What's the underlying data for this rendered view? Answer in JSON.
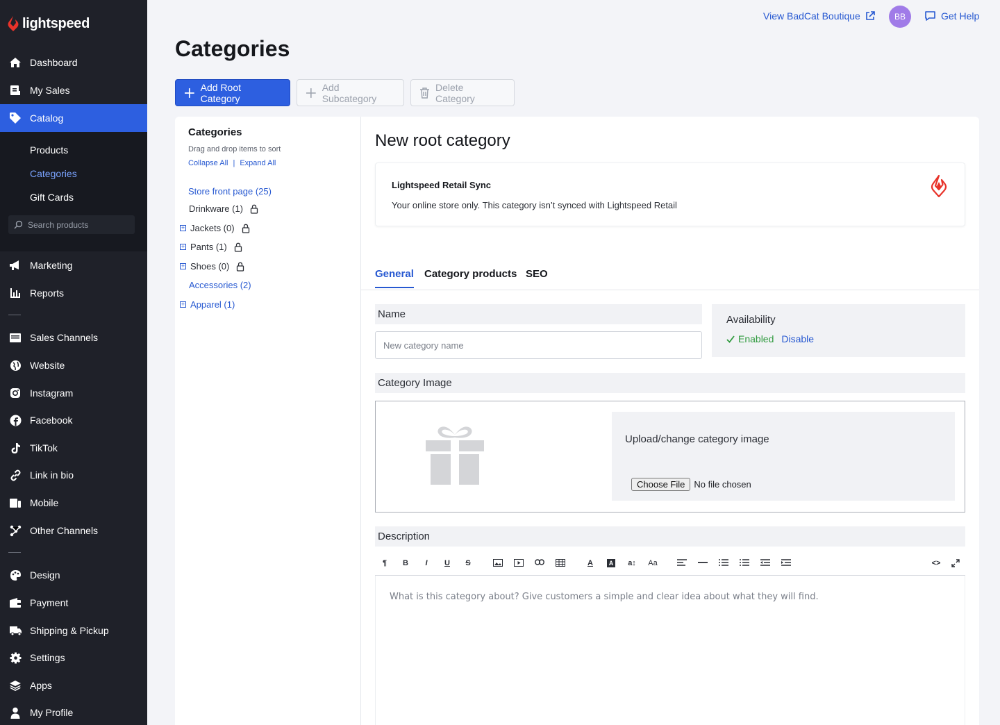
{
  "brand": {
    "name": "lightspeed",
    "accent": "#2d5fe0",
    "logo_red": "#e8332a"
  },
  "sidebar": {
    "items": [
      {
        "label": "Dashboard",
        "icon": "home-icon"
      },
      {
        "label": "My Sales",
        "icon": "sales-icon"
      },
      {
        "label": "Catalog",
        "icon": "tag-icon"
      },
      {
        "label": "Marketing",
        "icon": "megaphone-icon"
      },
      {
        "label": "Reports",
        "icon": "bar-chart-icon"
      },
      {
        "label": "Sales Channels",
        "icon": "storefront-icon"
      },
      {
        "label": "Website",
        "icon": "globe-icon"
      },
      {
        "label": "Instagram",
        "icon": "instagram-icon"
      },
      {
        "label": "Facebook",
        "icon": "facebook-icon"
      },
      {
        "label": "TikTok",
        "icon": "tiktok-icon"
      },
      {
        "label": "Link in bio",
        "icon": "link-icon"
      },
      {
        "label": "Mobile",
        "icon": "mobile-icon"
      },
      {
        "label": "Other Channels",
        "icon": "channels-icon"
      },
      {
        "label": "Design",
        "icon": "palette-icon"
      },
      {
        "label": "Payment",
        "icon": "wallet-icon"
      },
      {
        "label": "Shipping & Pickup",
        "icon": "truck-icon"
      },
      {
        "label": "Settings",
        "icon": "gear-icon"
      },
      {
        "label": "Apps",
        "icon": "layers-icon"
      },
      {
        "label": "My Profile",
        "icon": "user-icon"
      }
    ],
    "catalog_sub": [
      "Products",
      "Categories",
      "Gift Cards"
    ],
    "search_placeholder": "Search products"
  },
  "topbar": {
    "view_store": "View BadCat Boutique",
    "avatar_initials": "BB",
    "help": "Get Help"
  },
  "page": {
    "title": "Categories",
    "buttons": {
      "add_root": "Add Root Category",
      "add_sub": "Add Subcategory",
      "delete": "Delete Category"
    }
  },
  "tree": {
    "title": "Categories",
    "hint": "Drag and drop items to sort",
    "collapse": "Collapse All",
    "expand": "Expand All",
    "nodes": [
      {
        "label": "Store front page (25)",
        "style": "link"
      },
      {
        "label": "Drinkware (1)",
        "style": "plain",
        "locked": true
      },
      {
        "label": "Jackets (0)",
        "style": "plain",
        "locked": true,
        "expandable": true
      },
      {
        "label": "Pants (1)",
        "style": "plain",
        "locked": true,
        "expandable": true
      },
      {
        "label": "Shoes (0)",
        "style": "plain",
        "locked": true,
        "expandable": true
      },
      {
        "label": "Accessories (2)",
        "style": "link"
      },
      {
        "label": "Apparel (1)",
        "style": "link",
        "expandable": true
      }
    ]
  },
  "detail": {
    "title": "New root category",
    "sync_title": "Lightspeed Retail Sync",
    "sync_desc": "Your online store only. This category isn’t synced with Lightspeed Retail",
    "tabs": [
      "General",
      "Category products",
      "SEO"
    ],
    "name_label": "Name",
    "name_placeholder": "New category name",
    "availability_label": "Availability",
    "enabled": "Enabled",
    "disable": "Disable",
    "image_label": "Category Image",
    "upload_title": "Upload/change category image",
    "choose_file": "Choose File",
    "no_file": "No file chosen",
    "description_label": "Description",
    "description_placeholder": "What is this category about? Give customers a simple and clear idea about what they will find."
  }
}
